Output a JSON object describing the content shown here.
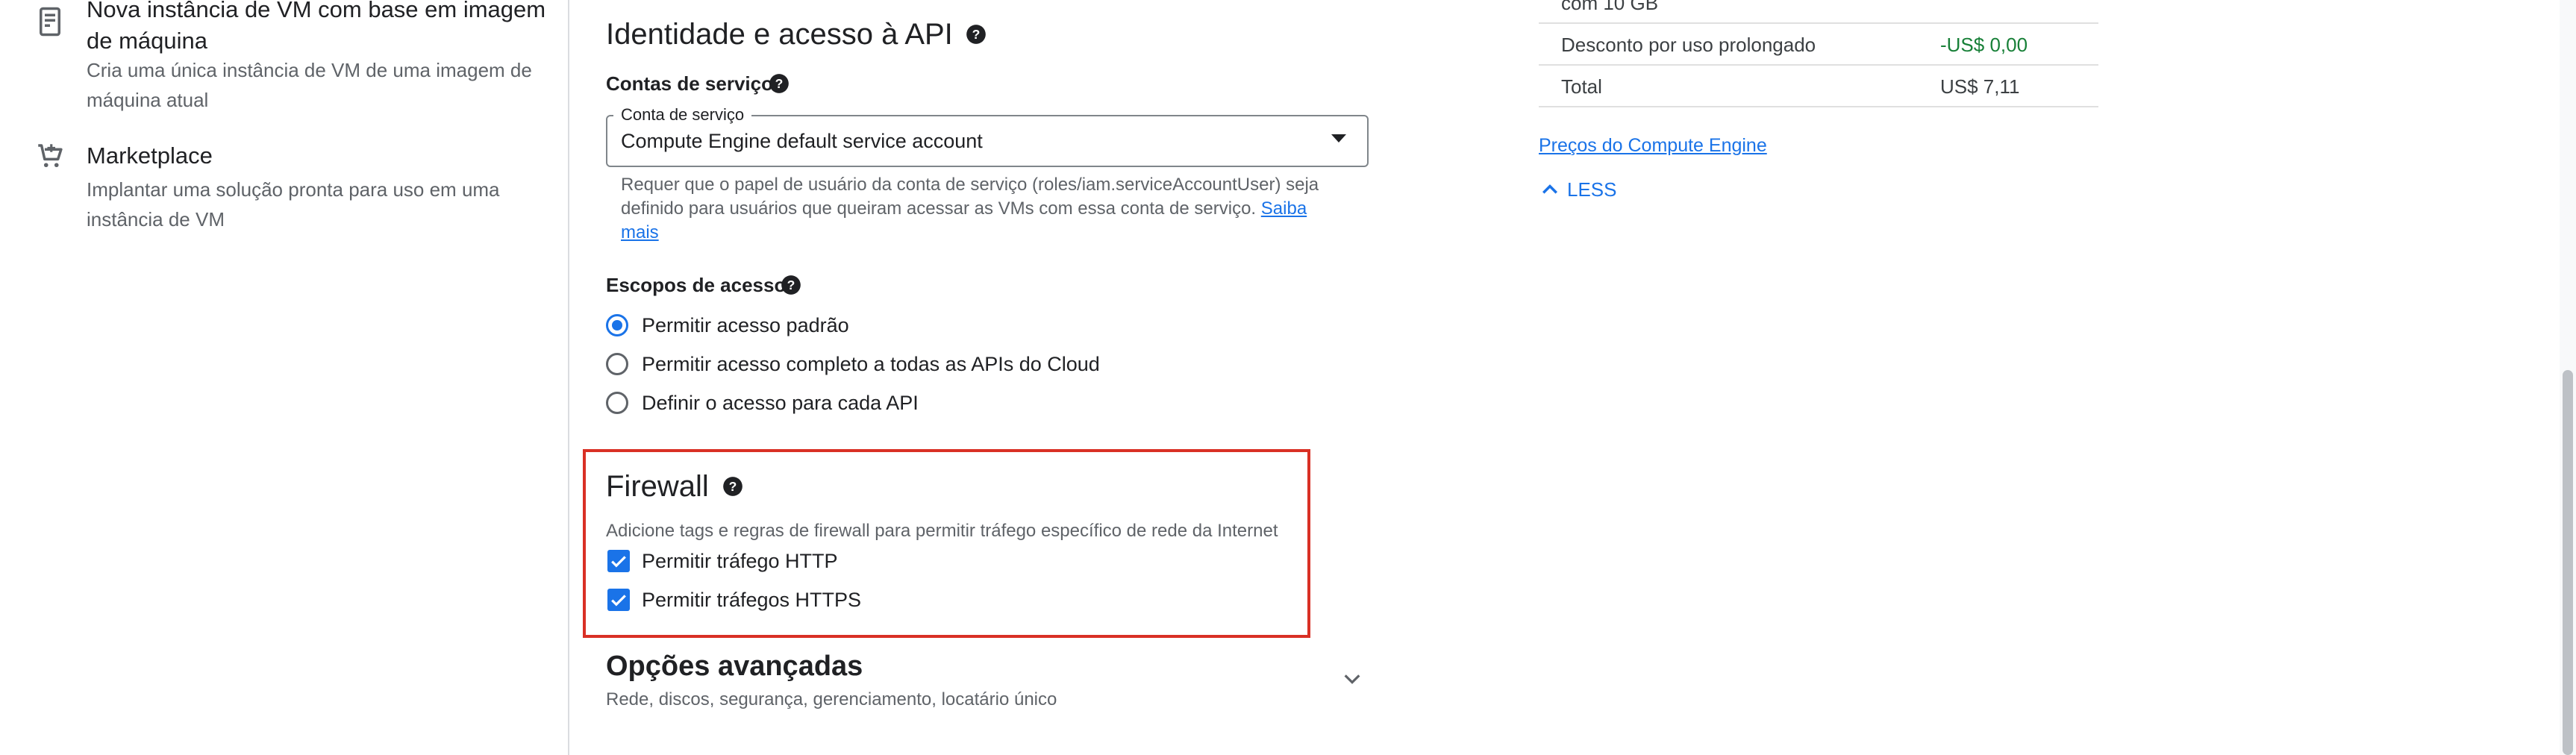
{
  "left_panel": {
    "items": [
      {
        "icon": "machine-image-icon",
        "title": "Nova instância de VM com base em imagem de máquina",
        "description": "Cria uma única instância de VM de uma imagem de máquina atual"
      },
      {
        "icon": "cart-icon",
        "title": "Marketplace",
        "description": "Implantar uma solução pronta para uso em uma instância de VM"
      }
    ]
  },
  "identity": {
    "title": "Identidade e acesso à API",
    "service_accounts_label": "Contas de serviço",
    "service_account_field_label": "Conta de serviço",
    "service_account_value": "Compute Engine default service account",
    "hint": "Requer que o papel de usuário da conta de serviço (roles/iam.serviceAccountUser) seja definido para usuários que queiram acessar as VMs com essa conta de serviço.",
    "hint_link": "Saiba mais",
    "access_scopes_label": "Escopos de acesso",
    "scopes": [
      {
        "label": "Permitir acesso padrão",
        "selected": true
      },
      {
        "label": "Permitir acesso completo a todas as APIs do Cloud",
        "selected": false
      },
      {
        "label": "Definir o acesso para cada API",
        "selected": false
      }
    ]
  },
  "firewall": {
    "title": "Firewall",
    "description": "Adicione tags e regras de firewall para permitir tráfego específico de rede da Internet",
    "options": [
      {
        "label": "Permitir tráfego HTTP",
        "checked": true
      },
      {
        "label": "Permitir tráfegos HTTPS",
        "checked": true
      }
    ]
  },
  "advanced": {
    "title": "Opções avançadas",
    "description": "Rede, discos, segurança, gerenciamento, locatário único"
  },
  "pricing": {
    "partial_row_text": "com 10 GB",
    "rows": [
      {
        "label": "Desconto por uso prolongado",
        "value": "-US$ 0,00",
        "color": "#188038"
      },
      {
        "label": "Total",
        "value": "US$ 7,11",
        "color": "#3c4043"
      }
    ],
    "link": "Preços do Compute Engine",
    "less_label": "LESS"
  }
}
